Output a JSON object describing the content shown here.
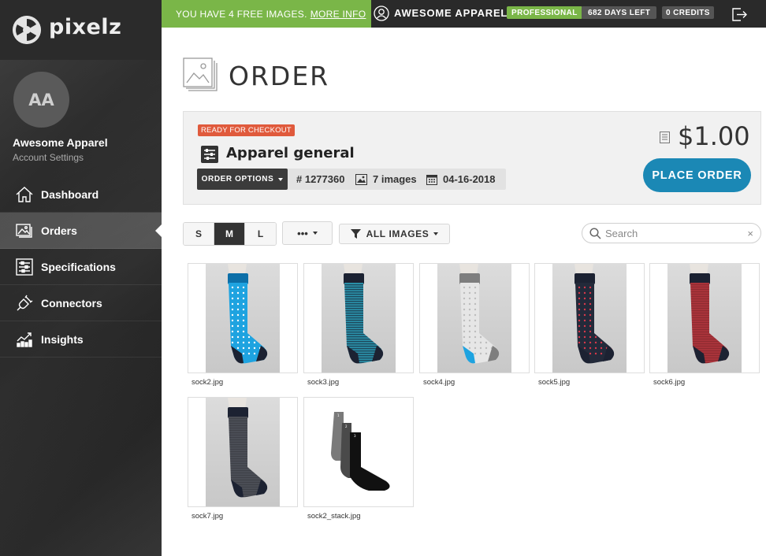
{
  "brand": {
    "name": "pixelz"
  },
  "account": {
    "initials": "AA",
    "name": "Awesome Apparel",
    "settings_label": "Account Settings"
  },
  "nav": [
    {
      "label": "Dashboard",
      "icon": "home-icon"
    },
    {
      "label": "Orders",
      "icon": "images-icon",
      "active": true
    },
    {
      "label": "Specifications",
      "icon": "sliders-icon"
    },
    {
      "label": "Connectors",
      "icon": "plug-icon"
    },
    {
      "label": "Insights",
      "icon": "chart-icon"
    }
  ],
  "topbar": {
    "promo_text": "YOU HAVE 4 FREE IMAGES.",
    "promo_link": "MORE INFO",
    "company": "AWESOME APPAREL",
    "plan": "PROFESSIONAL",
    "days_left": "682 DAYS LEFT",
    "credits": "0 CREDITS"
  },
  "page": {
    "title": "ORDER"
  },
  "order": {
    "status": "READY FOR CHECKOUT",
    "spec_name": "Apparel general",
    "options_label": "ORDER OPTIONS",
    "number": "# 1277360",
    "image_count": "7 images",
    "date": "04-16-2018",
    "price": "$1.00",
    "place_order_label": "PLACE ORDER"
  },
  "toolbar": {
    "sizes": [
      "S",
      "M",
      "L"
    ],
    "active_size": "M",
    "more_label": "•••",
    "filter_label": "ALL IMAGES",
    "search_placeholder": "Search",
    "clear_label": "×"
  },
  "images": [
    {
      "name": "sock2.jpg",
      "color": "#1ea3e0",
      "pattern": "dots",
      "accent": "#ffffff"
    },
    {
      "name": "sock3.jpg",
      "color": "#2a8fa8",
      "pattern": "stripes",
      "accent": "#1a2a3a"
    },
    {
      "name": "sock4.jpg",
      "color": "#e6e6e6",
      "pattern": "dots",
      "accent": "#bdbdbd"
    },
    {
      "name": "sock5.jpg",
      "color": "#232a3a",
      "pattern": "dots",
      "accent": "#d8394a"
    },
    {
      "name": "sock6.jpg",
      "color": "#a8333a",
      "pattern": "texture",
      "accent": "#1b2130"
    },
    {
      "name": "sock7.jpg",
      "color": "#4a4d55",
      "pattern": "texture",
      "accent": "#20232b"
    },
    {
      "name": "sock2_stack.jpg",
      "color": "#111111",
      "pattern": "stack",
      "accent": "#555555"
    }
  ]
}
